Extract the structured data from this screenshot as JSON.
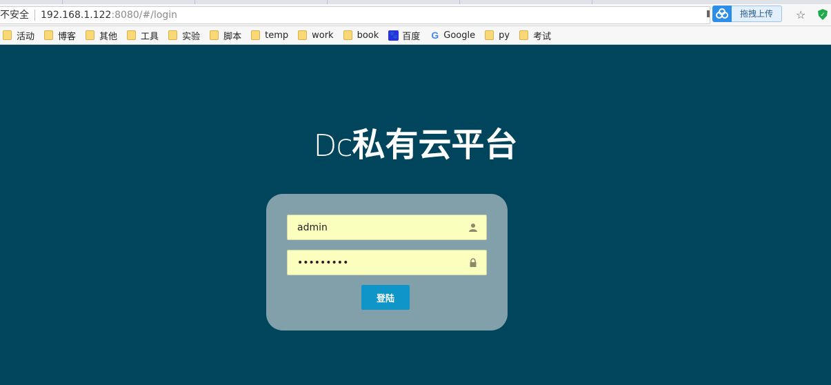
{
  "browser": {
    "security_label": "不安全",
    "url_host": "192.168.1.122",
    "url_rest": ":8080/#/login",
    "upload_button": "拖拽上传",
    "star_icon": "☆",
    "bookmarks": [
      {
        "label": "活动",
        "icon": "folder-icon"
      },
      {
        "label": "博客",
        "icon": "folder-icon"
      },
      {
        "label": "其他",
        "icon": "folder-icon"
      },
      {
        "label": "工具",
        "icon": "folder-icon"
      },
      {
        "label": "实验",
        "icon": "folder-icon"
      },
      {
        "label": "脚本",
        "icon": "folder-icon"
      },
      {
        "label": "temp",
        "icon": "folder-icon"
      },
      {
        "label": "work",
        "icon": "folder-icon"
      },
      {
        "label": "book",
        "icon": "folder-icon"
      },
      {
        "label": "百度",
        "icon": "baidu-paw-icon"
      },
      {
        "label": "Google",
        "icon": "google-icon"
      },
      {
        "label": "py",
        "icon": "folder-icon"
      },
      {
        "label": "考试",
        "icon": "folder-icon"
      }
    ]
  },
  "page": {
    "title_latin": "Dc",
    "title_cjk": "私有云平台",
    "background_color": "#00455b",
    "username_value": "admin",
    "password_value": "•••••••••",
    "login_button": "登陆",
    "accent_color": "#0f95c7"
  }
}
